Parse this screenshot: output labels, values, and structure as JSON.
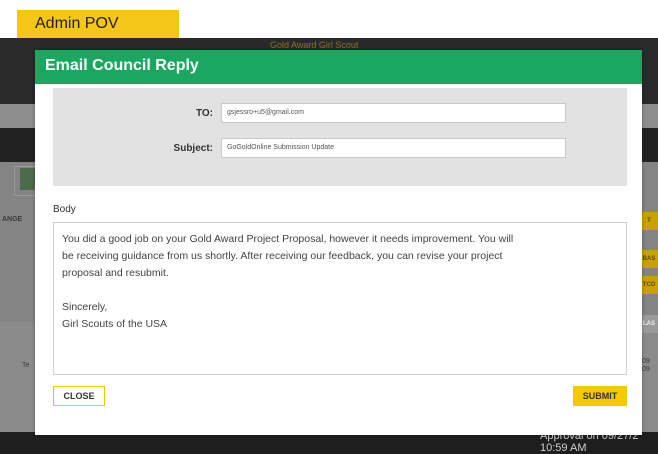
{
  "pov_tag": "Admin POV",
  "background": {
    "header_text": "Gold Award Girl Scout",
    "left_label": "ANGE",
    "left_lower_label": "Te",
    "right_chips": [
      "T",
      "BAS",
      "TCO",
      "LAS"
    ],
    "right_dates": [
      "09",
      "09"
    ],
    "approval_line1": "Approval on 09/27/2",
    "approval_line2": "10:59 AM"
  },
  "modal": {
    "title": "Email Council Reply",
    "to_label": "TO:",
    "to_value": "gsjessro+u5@gmail.com",
    "subject_label": "Subject:",
    "subject_value": "GoGoldOnline Submission Update",
    "body_label": "Body",
    "body": {
      "line1": "You did a good job on your Gold Award Project Proposal, however it needs improvement. You will",
      "line2": "be receiving guidance from us shortly. After receiving our feedback, you can revise your project",
      "line3": "proposal and resubmit.",
      "line4": "Sincerely,",
      "line5": "Girl Scouts of the USA"
    },
    "close_label": "CLOSE",
    "submit_label": "SUBMIT"
  },
  "colors": {
    "header_green": "#1aa760",
    "accent_yellow": "#f7c900"
  }
}
